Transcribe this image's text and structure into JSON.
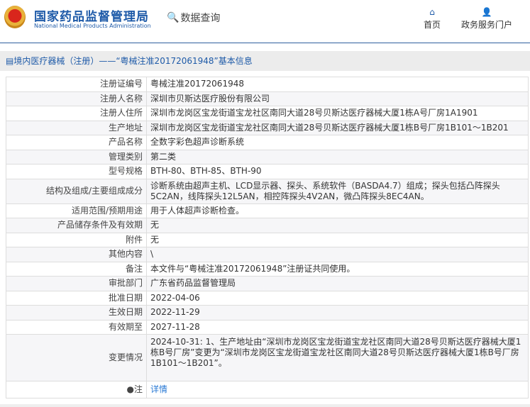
{
  "header": {
    "title": "国家药品监督管理局",
    "subtitle": "National Medical Products Administration",
    "query_label": "数据查询",
    "nav": [
      {
        "label": "首页",
        "icon": "home-icon"
      },
      {
        "label": "政务服务门户",
        "icon": "user-icon"
      }
    ]
  },
  "breadcrumb": "境内医疗器械（注册）——“粤械注准20172061948”基本信息",
  "rows": [
    {
      "label": "注册证编号",
      "value": "粤械注准20172061948"
    },
    {
      "label": "注册人名称",
      "value": "深圳市贝斯达医疗股份有限公司"
    },
    {
      "label": "注册人住所",
      "value": "深圳市龙岗区宝龙街道宝龙社区南同大道28号贝斯达医疗器械大厦1栋A号厂房1A1901"
    },
    {
      "label": "生产地址",
      "value": "深圳市龙岗区宝龙街道宝龙社区南同大道28号贝斯达医疗器械大厦1栋B号厂房1B101～1B201"
    },
    {
      "label": "产品名称",
      "value": "全数字彩色超声诊断系统"
    },
    {
      "label": "管理类别",
      "value": "第二类"
    },
    {
      "label": "型号规格",
      "value": "BTH-80、BTH-85、BTH-90"
    },
    {
      "label": "结构及组成/主要组成成分",
      "value": "诊断系统由超声主机、LCD显示器、探头、系统软件（BASDA4.7）组成；探头包括凸阵探头5C2AN，线阵探头12L5AN，相控阵探头4V2AN，微凸阵探头8EC4AN。"
    },
    {
      "label": "适用范围/预期用途",
      "value": "用于人体超声诊断检查。"
    },
    {
      "label": "产品储存条件及有效期",
      "value": "无"
    },
    {
      "label": "附件",
      "value": "无"
    },
    {
      "label": "其他内容",
      "value": "\\"
    },
    {
      "label": "备注",
      "value": "本文件与“粤械注准20172061948”注册证共同使用。"
    },
    {
      "label": "审批部门",
      "value": "广东省药品监督管理局"
    },
    {
      "label": "批准日期",
      "value": "2022-04-06"
    },
    {
      "label": "生效日期",
      "value": "2022-11-29"
    },
    {
      "label": "有效期至",
      "value": "2027-11-28"
    },
    {
      "label": "变更情况",
      "value": "2024-10-31: 1、生产地址由“深圳市龙岗区宝龙街道宝龙社区南同大道28号贝斯达医疗器械大厦1栋B号厂房”变更为“深圳市龙岗区宝龙街道宝龙社区南同大道28号贝斯达医疗器械大厦1栋B号厂房1B101～1B201”。"
    }
  ],
  "note": {
    "label": "注",
    "link": "详情"
  }
}
